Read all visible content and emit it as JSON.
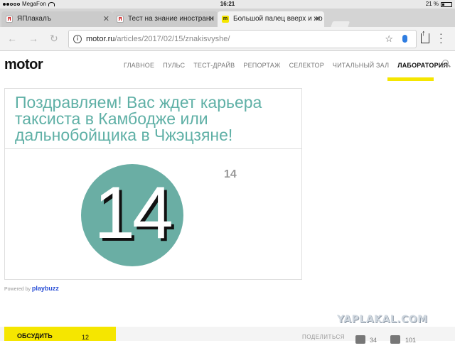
{
  "status": {
    "carrier": "MegaFon",
    "time": "16:21",
    "battery": "21 %"
  },
  "tabs": [
    {
      "title": "ЯПлакалъ",
      "icon": "yaplakal-favicon"
    },
    {
      "title": "Тест на знание иностранн",
      "icon": "yaplakal-favicon"
    },
    {
      "title": "Большой палец вверх и жо",
      "icon": "motor-favicon",
      "active": true
    }
  ],
  "address": {
    "domain": "motor.ru",
    "path": "/articles/2017/02/15/znakisvyshe/"
  },
  "site": {
    "logo": "motor",
    "nav": [
      "ГЛАВНОЕ",
      "ПУЛЬС",
      "ТЕСТ-ДРАЙВ",
      "РЕПОРТАЖ",
      "СЕЛЕКТОР",
      "ЧИТАЛЬНЫЙ ЗАЛ",
      "ЛАБОРАТОРИЯ"
    ],
    "active_nav": "ЛАБОРАТОРИЯ",
    "accent": "#f5e600"
  },
  "quiz": {
    "result_title": "Поздравляем! Вас ждет карьера таксиста в Камбодже или дальнобойщика в Чжэцзяне!",
    "score": "14",
    "score_small": "14",
    "title_color": "#5fb0a6",
    "circle_color": "#6aaea4",
    "powered_by": "Powered by",
    "powered_brand": "playbuzz"
  },
  "watermark": "YAPLAKAL.COM",
  "bottom": {
    "discuss": "ОБСУДИТЬ",
    "comments_count": "12",
    "share_label": "ПОДЕЛИТЬСЯ",
    "share1_count": "34",
    "share2_count": "101"
  }
}
